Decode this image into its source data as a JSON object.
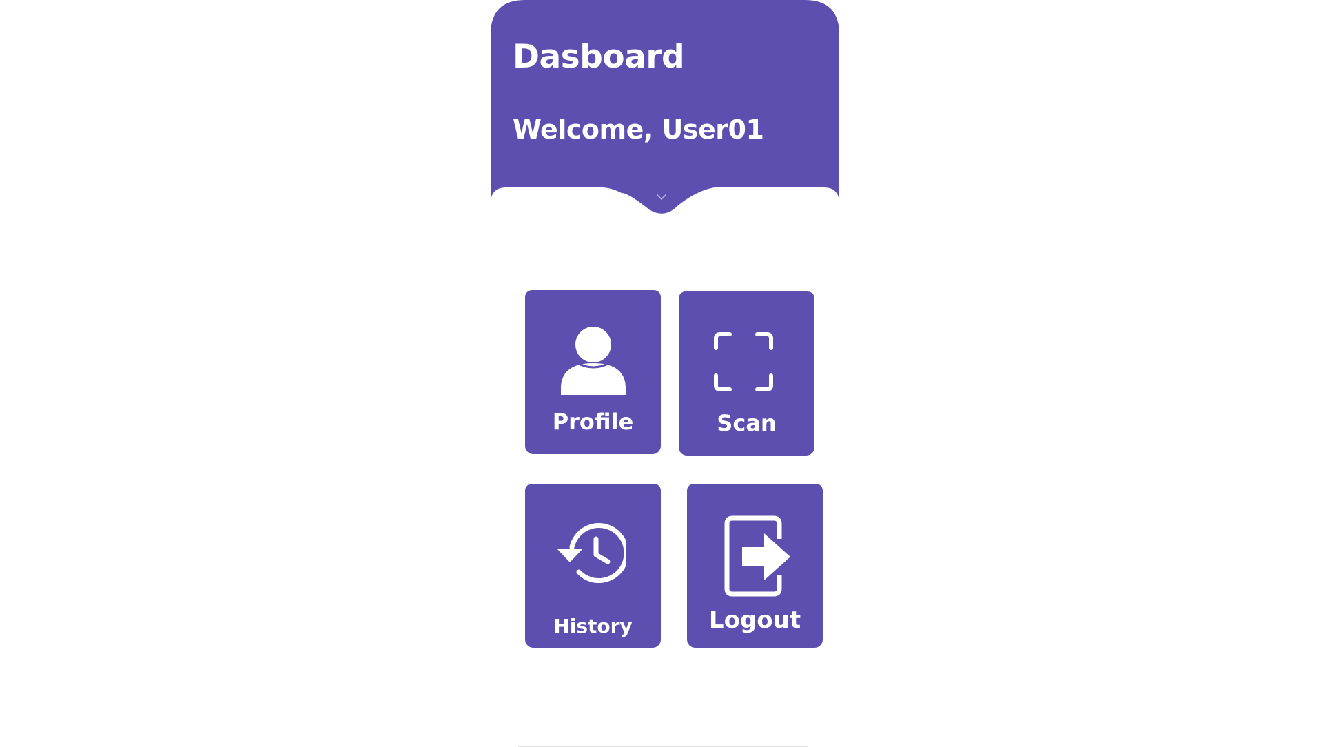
{
  "header": {
    "title": "Dasboard",
    "welcome": "Welcome, User01"
  },
  "tiles": [
    {
      "label": "Profile",
      "icon": "user-icon"
    },
    {
      "label": "Scan",
      "icon": "scan-frame-icon"
    },
    {
      "label": "History",
      "icon": "history-clock-icon"
    },
    {
      "label": "Logout",
      "icon": "logout-icon"
    }
  ],
  "colors": {
    "primary": "#5c4fb0",
    "text_on_primary": "#ffffff",
    "background": "#ffffff"
  }
}
